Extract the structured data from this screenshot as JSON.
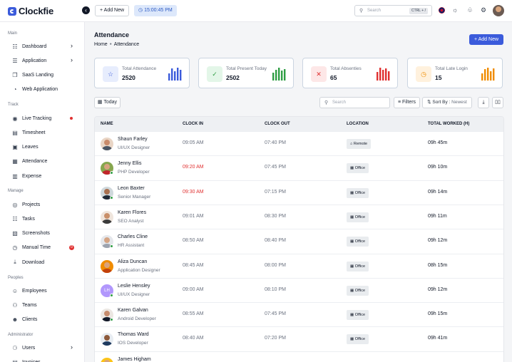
{
  "app": {
    "name": "Clockfie"
  },
  "topbar": {
    "add_new_label": "+ Add New",
    "clock_icon": "clock-icon",
    "clock_time": "15:00:45 PM",
    "search_placeholder": "Search",
    "search_shortcut": "CTRL + /",
    "icons": [
      "flag-uk-icon",
      "sun-icon",
      "bell-icon",
      "gear-icon"
    ]
  },
  "sidebar": {
    "sections": [
      {
        "title": "Main",
        "items": [
          {
            "label": "Dashboard",
            "icon": "grid-icon",
            "chevron": true
          },
          {
            "label": "Application",
            "icon": "apps-icon",
            "chevron": true
          },
          {
            "label": "SaaS Landing",
            "icon": "layers-icon"
          },
          {
            "label": "Web Application",
            "icon": "globe-icon"
          }
        ]
      },
      {
        "title": "Track",
        "items": [
          {
            "label": "Live Tracking",
            "icon": "tracking-icon",
            "dot": true
          },
          {
            "label": "Timesheet",
            "icon": "timesheet-icon"
          },
          {
            "label": "Leaves",
            "icon": "leaves-icon"
          },
          {
            "label": "Attendance",
            "icon": "calendar-check-icon"
          },
          {
            "label": "Expense",
            "icon": "wallet-icon"
          }
        ]
      },
      {
        "title": "Manage",
        "items": [
          {
            "label": "Projects",
            "icon": "projects-icon"
          },
          {
            "label": "Tasks",
            "icon": "tasks-icon"
          },
          {
            "label": "Screenshots",
            "icon": "screenshot-icon"
          },
          {
            "label": "Manual Time",
            "icon": "manual-time-icon",
            "badge": "0"
          },
          {
            "label": "Download",
            "icon": "download-icon"
          }
        ]
      },
      {
        "title": "Peoples",
        "items": [
          {
            "label": "Employees",
            "icon": "employee-icon"
          },
          {
            "label": "Teams",
            "icon": "teams-icon"
          },
          {
            "label": "Clients",
            "icon": "clients-icon"
          }
        ]
      },
      {
        "title": "Administrator",
        "items": [
          {
            "label": "Users",
            "icon": "users-icon",
            "chevron": true
          },
          {
            "label": "Invoices",
            "icon": "invoice-icon"
          }
        ]
      }
    ]
  },
  "page": {
    "title": "Attendance",
    "breadcrumb": [
      "Home",
      "Attendance"
    ],
    "add_new_label": "+ Add New"
  },
  "stats": [
    {
      "label": "Total Attendance",
      "value": "2520",
      "color": "#3b5bdb",
      "bg": "#e7edfd",
      "icon": "user-star-icon"
    },
    {
      "label": "Total Present Today",
      "value": "2502",
      "color": "#2f9e44",
      "bg": "#e3f6e8",
      "icon": "user-check-icon"
    },
    {
      "label": "Total Absenties",
      "value": "65",
      "color": "#e03131",
      "bg": "#fde7e7",
      "icon": "user-x-icon"
    },
    {
      "label": "Total Late Login",
      "value": "15",
      "color": "#f08c00",
      "bg": "#fff1dd",
      "icon": "user-clock-icon"
    }
  ],
  "toolbar": {
    "today_label": "Today",
    "search_placeholder": "Search",
    "filters_label": "Filters",
    "sort_prefix": "Sort By :",
    "sort_value": "Newest"
  },
  "table": {
    "columns": [
      "NAME",
      "CLOCK IN",
      "CLOCK OUT",
      "LOCATION",
      "TOTAL WORKED (H)"
    ],
    "rows": [
      {
        "name": "Shaun Farley",
        "role": "UI/UX Designer",
        "clock_in": "09:05 AM",
        "clock_out": "07:40 PM",
        "location": "Remote",
        "location_icon": "home-icon",
        "total": "09h 45m",
        "late": false,
        "online": false,
        "skin": "#c98b6b",
        "shirt": "#4b5563",
        "bg": "#e9d5c5"
      },
      {
        "name": "Jenny Ellis",
        "role": "PHP Developer",
        "clock_in": "09:20 AM",
        "clock_out": "07:45 PM",
        "location": "Office",
        "location_icon": "building-icon",
        "total": "09h 10m",
        "late": true,
        "online": true,
        "skin": "#d7a27f",
        "shirt": "#c1262b",
        "bg": "#86a64e"
      },
      {
        "name": "Leon Baxter",
        "role": "Senior Manager",
        "clock_in": "09:30 AM",
        "clock_out": "07:15 PM",
        "location": "Office",
        "location_icon": "building-icon",
        "total": "09h 14m",
        "late": true,
        "online": true,
        "skin": "#a87050",
        "shirt": "#1f2937",
        "bg": "#cfd8dc"
      },
      {
        "name": "Karen Flores",
        "role": "SEO Analyst",
        "clock_in": "09:01 AM",
        "clock_out": "08:30 PM",
        "location": "Office",
        "location_icon": "building-icon",
        "total": "09h 11m",
        "late": false,
        "online": false,
        "skin": "#c98f69",
        "shirt": "#3b3b3b",
        "bg": "#efe5dc"
      },
      {
        "name": "Charles Cline",
        "role": "HR Assistant",
        "clock_in": "08:50 AM",
        "clock_out": "08:40 PM",
        "location": "Office",
        "location_icon": "building-icon",
        "total": "09h 12m",
        "late": false,
        "online": true,
        "skin": "#d4a484",
        "shirt": "#9ca3af",
        "bg": "#e5e7eb"
      },
      {
        "name": "Aliza Duncan",
        "role": "Application Designer",
        "clock_in": "08:45 AM",
        "clock_out": "08:00 PM",
        "location": "Office",
        "location_icon": "building-icon",
        "total": "08h 15m",
        "late": false,
        "online": false,
        "skin": "#d9a37c",
        "shirt": "#c2410c",
        "bg": "#f08c00"
      },
      {
        "name": "Leslie Hensley",
        "role": "UI/UX Designer",
        "initials": "LH",
        "clock_in": "09:00 AM",
        "clock_out": "08:10 PM",
        "location": "Office",
        "location_icon": "building-icon",
        "total": "09h 12m",
        "late": false,
        "online": true,
        "skin": "#b197fc",
        "shirt": "#b197fc",
        "bg": "#b197fc"
      },
      {
        "name": "Karen Galvan",
        "role": "Android Developer",
        "clock_in": "08:55 AM",
        "clock_out": "07:45 PM",
        "location": "Office",
        "location_icon": "building-icon",
        "total": "09h 15m",
        "late": false,
        "online": true,
        "skin": "#c68b6c",
        "shirt": "#111827",
        "bg": "#ece7e2"
      },
      {
        "name": "Thomas Ward",
        "role": "IOS Developer",
        "clock_in": "08:40 AM",
        "clock_out": "07:20 PM",
        "location": "Office",
        "location_icon": "building-icon",
        "total": "09h 41m",
        "late": false,
        "online": false,
        "skin": "#8d5a3c",
        "shirt": "#1e3a5f",
        "bg": "#e8edf2"
      },
      {
        "name": "James Higham",
        "role": "",
        "clock_in": "",
        "clock_out": "",
        "location": "",
        "location_icon": "",
        "total": "",
        "late": false,
        "online": false,
        "skin": "#d9a37c",
        "shirt": "#f59f00",
        "bg": "#fcc419"
      }
    ]
  }
}
